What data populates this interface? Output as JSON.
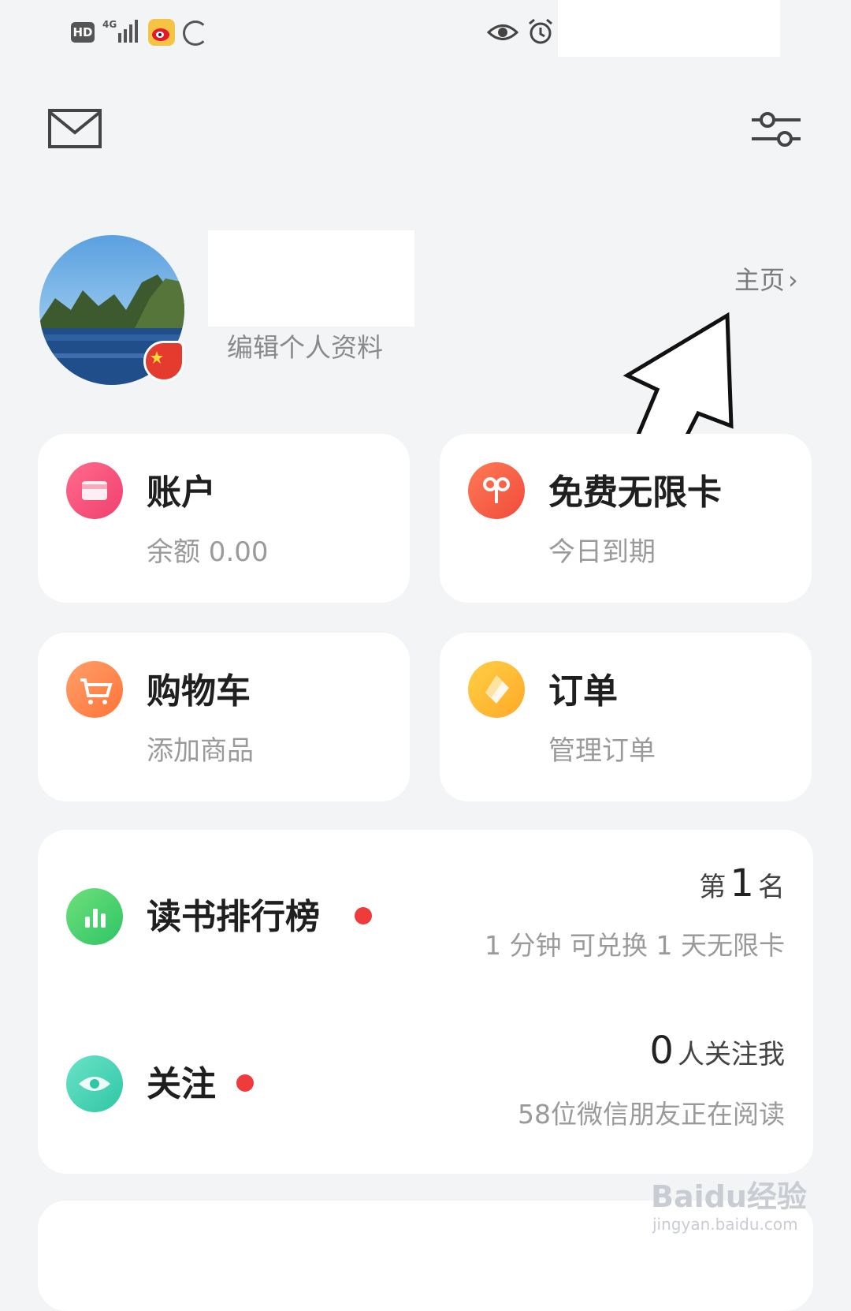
{
  "status_bar": {
    "hd": "HD"
  },
  "profile": {
    "edit_label": "编辑个人资料",
    "homepage_label": "主页"
  },
  "grid": [
    {
      "title": "账户",
      "subtitle": "余额 0.00",
      "icon": "wallet-icon",
      "color": "#f04070"
    },
    {
      "title": "免费无限卡",
      "subtitle": "今日到期",
      "icon": "bow-icon",
      "color": "#f04b3b"
    },
    {
      "title": "购物车",
      "subtitle": "添加商品",
      "icon": "cart-icon",
      "color": "#ff7338"
    },
    {
      "title": "订单",
      "subtitle": "管理订单",
      "icon": "diamond-icon",
      "color": "#ffa928"
    }
  ],
  "rank": {
    "title": "读书排行榜",
    "prefix": "第",
    "number": "1",
    "suffix": "名",
    "subtitle": "1 分钟 可兑换 1 天无限卡"
  },
  "follow": {
    "title": "关注",
    "count": "0",
    "count_label": "人关注我",
    "subtitle": "58位微信朋友正在阅读"
  },
  "watermark": {
    "main": "Baidu经验",
    "sub": "jingyan.baidu.com"
  }
}
